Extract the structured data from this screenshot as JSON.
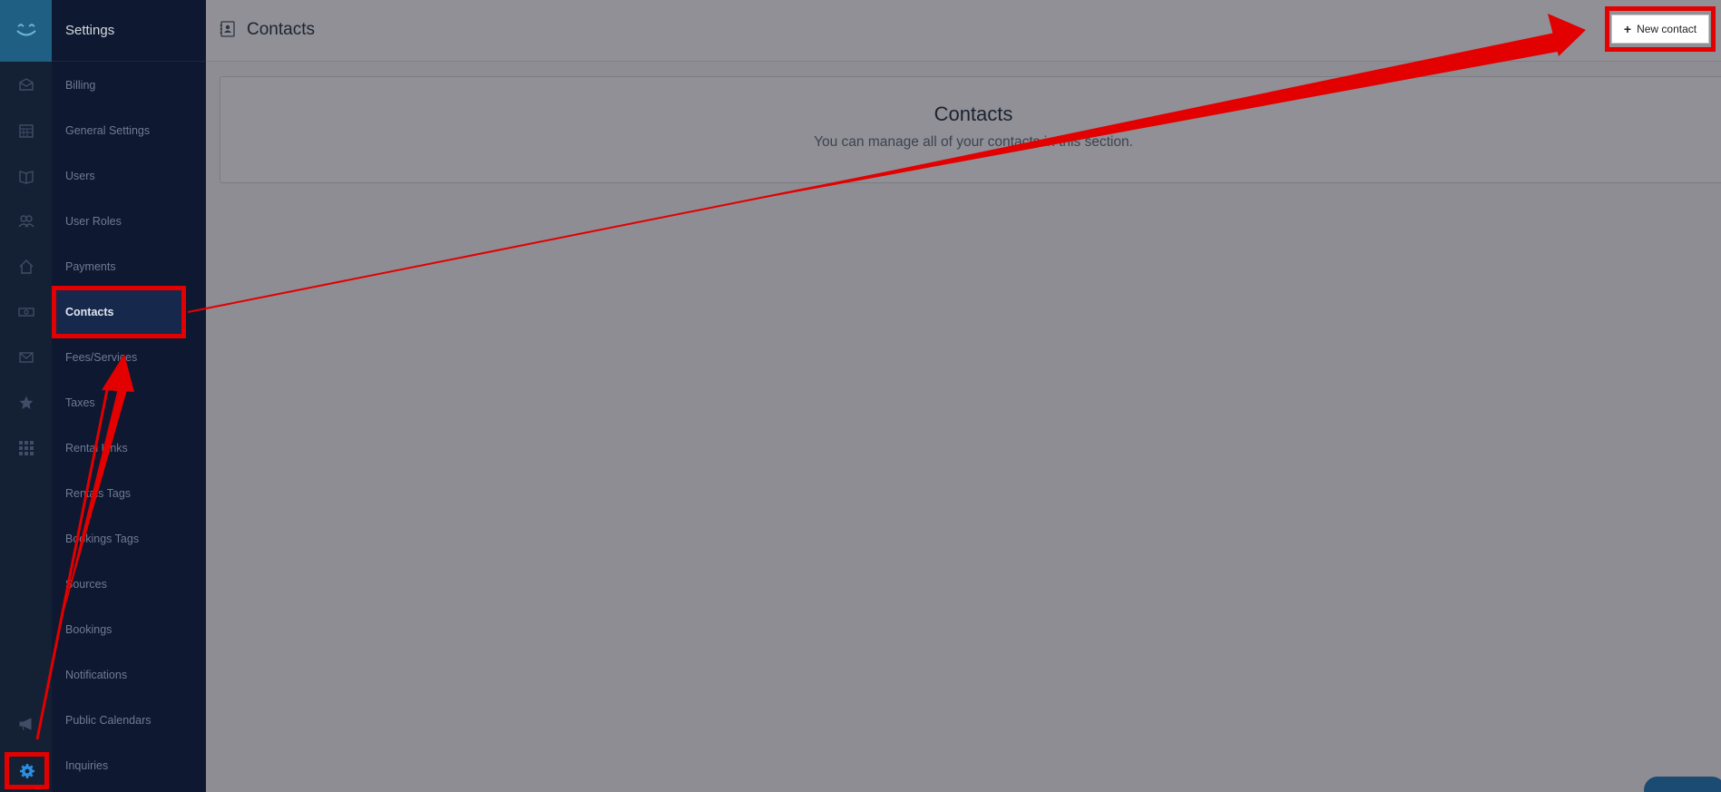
{
  "menu": {
    "header": "Settings",
    "items": [
      {
        "label": "Billing"
      },
      {
        "label": "General Settings"
      },
      {
        "label": "Users"
      },
      {
        "label": "User Roles"
      },
      {
        "label": "Payments"
      },
      {
        "label": "Contacts",
        "active": true
      },
      {
        "label": "Fees/Services"
      },
      {
        "label": "Taxes"
      },
      {
        "label": "Rental Links"
      },
      {
        "label": "Rentals Tags"
      },
      {
        "label": "Bookings Tags"
      },
      {
        "label": "Sources"
      },
      {
        "label": "Bookings"
      },
      {
        "label": "Notifications"
      },
      {
        "label": "Public Calendars"
      },
      {
        "label": "Inquiries"
      }
    ]
  },
  "rail": {
    "icons": [
      "inbox-icon",
      "calendar-icon",
      "book-icon",
      "users-icon",
      "home-icon",
      "money-icon",
      "mail-icon",
      "star-icon",
      "grid-icon",
      "megaphone-icon",
      "gear-icon"
    ]
  },
  "header": {
    "title": "Contacts",
    "new_button": "New contact"
  },
  "card": {
    "title": "Contacts",
    "subtitle": "You can manage all of your contacts in this section."
  },
  "colors": {
    "annotation": "#e20000",
    "rail_bg": "#142034",
    "menu_bg": "#0e1830",
    "logo_bg": "#1f5f84"
  }
}
